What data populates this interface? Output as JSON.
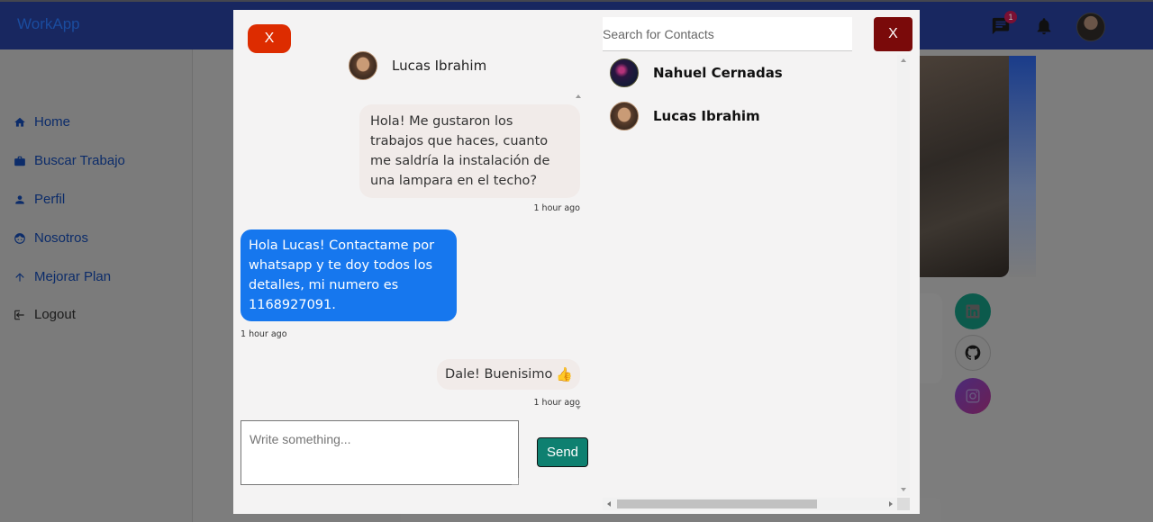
{
  "app": {
    "brand": "WorkApp"
  },
  "topbar": {
    "notification_count": "1"
  },
  "sidebar": {
    "items": [
      {
        "label": "Home",
        "icon": "home-icon"
      },
      {
        "label": "Buscar Trabajo",
        "icon": "briefcase-icon"
      },
      {
        "label": "Perfil",
        "icon": "person-icon"
      },
      {
        "label": "Nosotros",
        "icon": "face-icon"
      },
      {
        "label": "Mejorar Plan",
        "icon": "arrow-up-icon"
      },
      {
        "label": "Logout",
        "icon": "logout-icon"
      }
    ]
  },
  "chat": {
    "close_label": "X",
    "contact_name": "Lucas Ibrahim",
    "messages": [
      {
        "direction": "incoming",
        "text": "Hola! Me gustaron los trabajos que haces, cuanto me saldría la instalación de una lampara en el techo?",
        "time": "1 hour ago"
      },
      {
        "direction": "outgoing",
        "text": "Hola Lucas! Contactame por whatsapp y te doy todos los detalles, mi numero es 1168927091.",
        "time": "1 hour ago"
      },
      {
        "direction": "incoming",
        "text": "Dale! Buenisimo",
        "emoji": "👍",
        "time": "1 hour ago"
      }
    ],
    "input_placeholder": "Write something...",
    "send_label": "Send"
  },
  "contacts_panel": {
    "search_placeholder": "Search for Contacts",
    "close_label": "X",
    "contacts": [
      {
        "name": "Nahuel Cernadas"
      },
      {
        "name": "Lucas Ibrahim"
      }
    ]
  },
  "colors": {
    "topbar": "#182760",
    "outgoing_bubble": "#1677ee",
    "incoming_bubble": "#f1ebe9",
    "send_button": "#0e8070",
    "close_left": "#dd2c00",
    "close_right": "#7a0a0a"
  }
}
